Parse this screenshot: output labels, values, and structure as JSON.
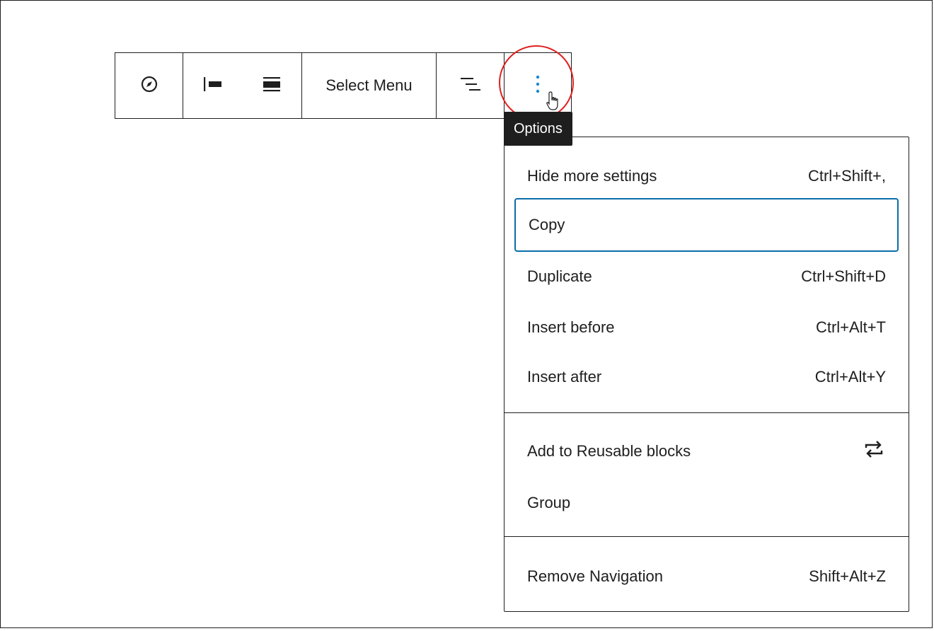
{
  "toolbar": {
    "select_menu_label": "Select Menu",
    "icons": [
      "compass-icon",
      "justify-left-icon",
      "justify-center-icon",
      "list-view-icon",
      "more-vertical-icon"
    ]
  },
  "tooltip": {
    "text": "Options"
  },
  "menu": {
    "sections": [
      [
        {
          "label": "Hide more settings",
          "shortcut": "Ctrl+Shift+,"
        },
        {
          "label": "Copy",
          "shortcut": ""
        },
        {
          "label": "Duplicate",
          "shortcut": "Ctrl+Shift+D"
        },
        {
          "label": "Insert before",
          "shortcut": "Ctrl+Alt+T"
        },
        {
          "label": "Insert after",
          "shortcut": "Ctrl+Alt+Y"
        }
      ],
      [
        {
          "label": "Add to Reusable blocks",
          "icon": "reusable-block-icon"
        },
        {
          "label": "Group"
        }
      ],
      [
        {
          "label": "Remove Navigation",
          "shortcut": "Shift+Alt+Z"
        }
      ]
    ]
  },
  "colors": {
    "focus": "#0a6ea8",
    "annotation": "#e0201f",
    "more_icon": "#1b8ad0",
    "text": "#1e1e1e"
  }
}
